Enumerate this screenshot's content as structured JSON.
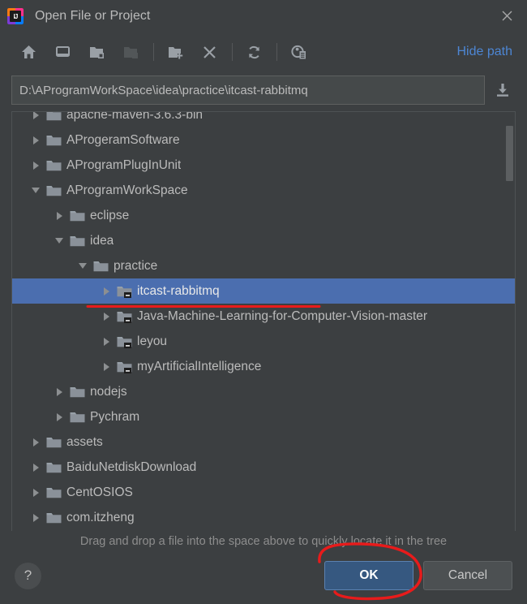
{
  "window": {
    "title": "Open File or Project",
    "logo_text": "IJ",
    "close_label": "Close"
  },
  "toolbar": {
    "items": [
      {
        "name": "home-icon",
        "tooltip": "Home",
        "disabled": false
      },
      {
        "name": "desktop-icon",
        "tooltip": "Desktop",
        "disabled": false
      },
      {
        "name": "folder-up-icon",
        "tooltip": "Up",
        "disabled": false
      },
      {
        "name": "folder-disabled-icon",
        "tooltip": "Project directory",
        "disabled": true
      },
      {
        "name": "new-folder-icon",
        "tooltip": "New Folder",
        "disabled": false
      },
      {
        "name": "delete-icon",
        "tooltip": "Delete",
        "disabled": false
      },
      {
        "name": "refresh-icon",
        "tooltip": "Refresh",
        "disabled": false
      },
      {
        "name": "show-hidden-icon",
        "tooltip": "Show Hidden Files",
        "disabled": false
      }
    ],
    "hide_path_label": "Hide path"
  },
  "path": {
    "value": "D:\\AProgramWorkSpace\\idea\\practice\\itcast-rabbitmq",
    "placeholder": "Path to file or project",
    "save_icon": "download-icon"
  },
  "tree": {
    "rows": [
      {
        "label": "apache-maven-3.6.3-bin",
        "depth": 1,
        "expander": "right",
        "icon": "folder-icon",
        "selected": false,
        "module": false,
        "clipped": "top"
      },
      {
        "label": "AProgeramSoftware",
        "depth": 1,
        "expander": "right",
        "icon": "folder-icon",
        "selected": false,
        "module": false
      },
      {
        "label": "AProgramPlugInUnit",
        "depth": 1,
        "expander": "right",
        "icon": "folder-icon",
        "selected": false,
        "module": false
      },
      {
        "label": "AProgramWorkSpace",
        "depth": 1,
        "expander": "down",
        "icon": "folder-icon",
        "selected": false,
        "module": false
      },
      {
        "label": "eclipse",
        "depth": 2,
        "expander": "right",
        "icon": "folder-icon",
        "selected": false,
        "module": false
      },
      {
        "label": "idea",
        "depth": 2,
        "expander": "down",
        "icon": "folder-icon",
        "selected": false,
        "module": false
      },
      {
        "label": "practice",
        "depth": 3,
        "expander": "down",
        "icon": "folder-icon",
        "selected": false,
        "module": false
      },
      {
        "label": "itcast-rabbitmq",
        "depth": 4,
        "expander": "right",
        "icon": "module-folder-icon",
        "selected": true,
        "module": true
      },
      {
        "label": "Java-Machine-Learning-for-Computer-Vision-master",
        "depth": 4,
        "expander": "right",
        "icon": "module-folder-icon",
        "selected": false,
        "module": true
      },
      {
        "label": "leyou",
        "depth": 4,
        "expander": "right",
        "icon": "module-folder-icon",
        "selected": false,
        "module": true
      },
      {
        "label": "myArtificialIntelligence",
        "depth": 4,
        "expander": "right",
        "icon": "module-folder-icon",
        "selected": false,
        "module": true
      },
      {
        "label": "nodejs",
        "depth": 2,
        "expander": "right",
        "icon": "folder-icon",
        "selected": false,
        "module": false
      },
      {
        "label": "Pychram",
        "depth": 2,
        "expander": "right",
        "icon": "folder-icon",
        "selected": false,
        "module": false
      },
      {
        "label": "assets",
        "depth": 1,
        "expander": "right",
        "icon": "folder-icon",
        "selected": false,
        "module": false
      },
      {
        "label": "BaiduNetdiskDownload",
        "depth": 1,
        "expander": "right",
        "icon": "folder-icon",
        "selected": false,
        "module": false
      },
      {
        "label": "CentOSIOS",
        "depth": 1,
        "expander": "right",
        "icon": "folder-icon",
        "selected": false,
        "module": false
      },
      {
        "label": "com.itzheng",
        "depth": 1,
        "expander": "right",
        "icon": "folder-icon",
        "selected": false,
        "module": false,
        "clipped": "bottom"
      }
    ],
    "scrollbar": {
      "visible": true
    }
  },
  "hint": {
    "text": "Drag and drop a file into the space above to quickly locate it in the tree"
  },
  "footer": {
    "help_label": "?",
    "ok_label": "OK",
    "cancel_label": "Cancel"
  },
  "annotations": {
    "color": "#e81b1b",
    "underline_on": "itcast-rabbitmq",
    "ellipse_on": "OK"
  },
  "colors": {
    "dialog_bg": "#3c3f41",
    "selection": "#4b6eaf",
    "link": "#4d86d4",
    "primary_button": "#365880",
    "text": "#bbbbbb",
    "annotation_red": "#e81b1b"
  }
}
